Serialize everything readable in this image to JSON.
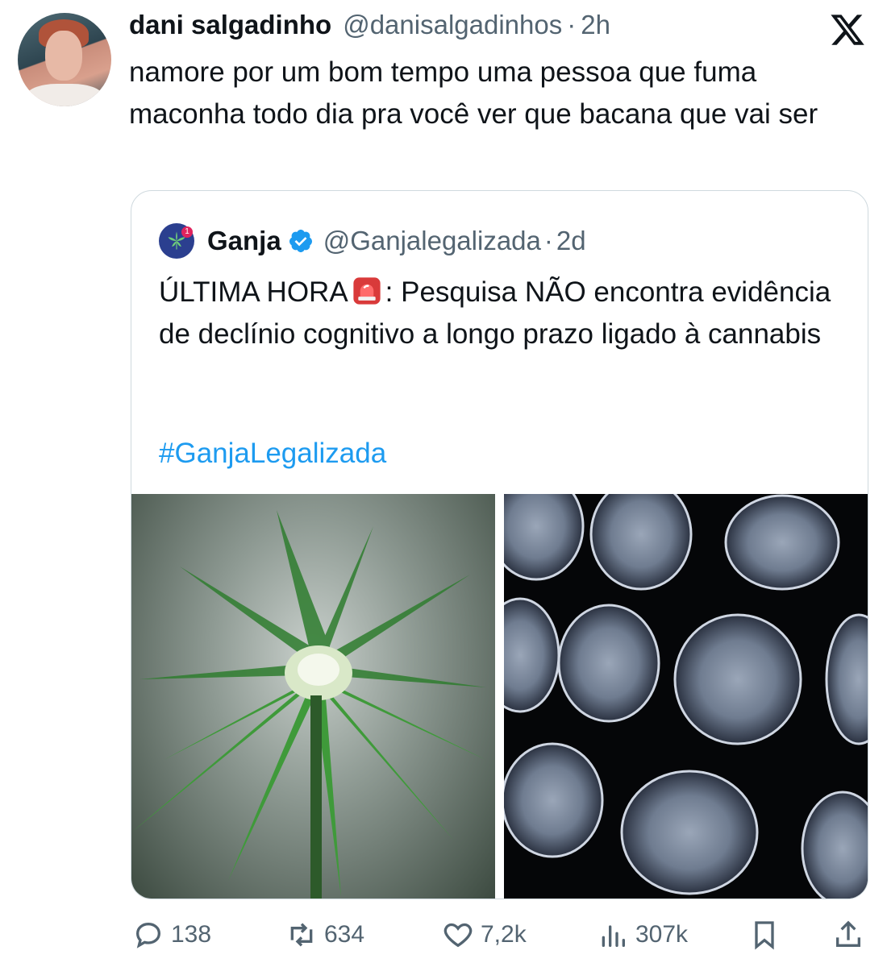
{
  "tweet": {
    "author_name": "dani salgadinho",
    "author_handle": "@danisalgadinhos",
    "separator": "·",
    "time": "2h",
    "text": "namore por um bom tempo uma pessoa que fuma maconha todo dia pra você ver que bacana que vai ser"
  },
  "quote": {
    "author_name": "Ganja",
    "author_handle": "@Ganjalegalizada",
    "separator": "·",
    "time": "2d",
    "text_before_emoji": "ÚLTIMA HORA",
    "text_after_emoji": ": Pesquisa NÃO encontra evidência de declínio cognitivo a longo prazo ligado à cannabis",
    "hashtag": "#GanjaLegalizada",
    "emoji_icon": "siren-icon",
    "avatar_badge": "1"
  },
  "actions": {
    "replies": "138",
    "reposts": "634",
    "likes": "7,2k",
    "views": "307k"
  },
  "colors": {
    "text": "#0f1419",
    "secondary": "#536471",
    "link": "#1d9bf0",
    "border": "#cfd9de",
    "verified": "#1d9bf0"
  }
}
